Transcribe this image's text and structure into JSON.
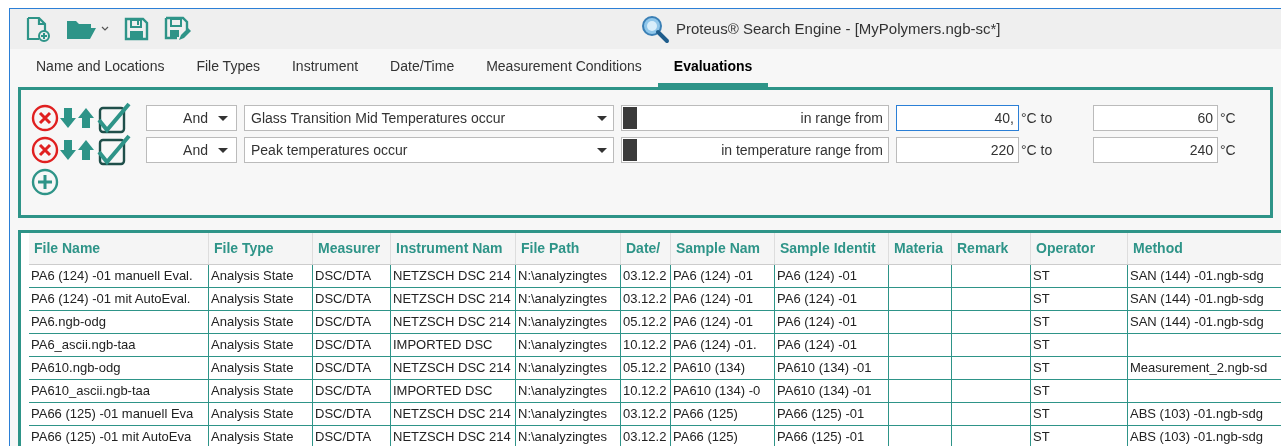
{
  "window": {
    "title": "Proteus® Search Engine - [MyPolymers.ngb-sc*]"
  },
  "tabs": [
    {
      "label": "Name and Locations",
      "selected": false
    },
    {
      "label": "File Types",
      "selected": false
    },
    {
      "label": "Instrument",
      "selected": false
    },
    {
      "label": "Date/Time",
      "selected": false
    },
    {
      "label": "Measurement Conditions",
      "selected": false
    },
    {
      "label": "Evaluations",
      "selected": true
    }
  ],
  "conditions": [
    {
      "enabled": true,
      "operator": "And",
      "criterion": "Glass Transition Mid Temperatures occur",
      "range_label": "in range from",
      "from": {
        "value": "40,",
        "focused": true
      },
      "from_unit": "°C to",
      "to": {
        "value": "60",
        "focused": false
      },
      "to_unit": "°C"
    },
    {
      "enabled": true,
      "operator": "And",
      "criterion": "Peak temperatures occur",
      "range_label": "in temperature range from",
      "from": {
        "value": "220",
        "focused": false
      },
      "from_unit": "°C to",
      "to": {
        "value": "240",
        "focused": false
      },
      "to_unit": "°C"
    }
  ],
  "table": {
    "columns": [
      "File Name",
      "File Type",
      "Measurer",
      "Instrument Nam",
      "File Path",
      "Date/",
      "Sample Nam",
      "Sample Identit",
      "Materia",
      "Remark",
      "Operator",
      "Method"
    ],
    "rows": [
      [
        "PA6 (124) -01 manuell Eval.",
        "Analysis State",
        "DSC/DTA",
        "NETZSCH DSC 214",
        "N:\\analyzingtes",
        "03.12.2",
        "PA6 (124) -01",
        "PA6 (124) -01",
        "",
        "",
        "ST",
        "SAN (144) -01.ngb-sdg"
      ],
      [
        "PA6 (124) -01 mit AutoEval.",
        "Analysis State",
        "DSC/DTA",
        "NETZSCH DSC 214",
        "N:\\analyzingtes",
        "03.12.2",
        "PA6 (124) -01",
        "PA6 (124) -01",
        "",
        "",
        "ST",
        "SAN (144) -01.ngb-sdg"
      ],
      [
        "PA6.ngb-odg",
        "Analysis State",
        "DSC/DTA",
        "NETZSCH DSC 214",
        "N:\\analyzingtes",
        "05.12.2",
        "PA6 (124) -01",
        "PA6 (124) -01",
        "",
        "",
        "ST",
        "SAN (144) -01.ngb-sdg"
      ],
      [
        "PA6_ascii.ngb-taa",
        "Analysis State",
        "DSC/DTA",
        "IMPORTED DSC",
        "N:\\analyzingtes",
        "10.12.2",
        "PA6 (124) -01.",
        "PA6 (124) -01",
        "",
        "",
        "ST",
        ""
      ],
      [
        "PA610.ngb-odg",
        "Analysis State",
        "DSC/DTA",
        "NETZSCH DSC 214",
        "N:\\analyzingtes",
        "05.12.2",
        "PA610 (134)",
        "PA610 (134) -01",
        "",
        "",
        "ST",
        "Measurement_2.ngb-sd"
      ],
      [
        "PA610_ascii.ngb-taa",
        "Analysis State",
        "DSC/DTA",
        "IMPORTED DSC",
        "N:\\analyzingtes",
        "10.12.2",
        "PA610 (134) -0",
        "PA610 (134) -01",
        "",
        "",
        "ST",
        ""
      ],
      [
        "PA66 (125) -01 manuell Eva",
        "Analysis State",
        "DSC/DTA",
        "NETZSCH DSC 214",
        "N:\\analyzingtes",
        "03.12.2",
        "PA66 (125)",
        "PA66 (125) -01",
        "",
        "",
        "ST",
        "ABS (103) -01.ngb-sdg"
      ],
      [
        "PA66 (125) -01 mit AutoEva",
        "Analysis State",
        "DSC/DTA",
        "NETZSCH DSC 214",
        "N:\\analyzingtes",
        "03.12.2",
        "PA66 (125)",
        "PA66 (125) -01",
        "",
        "",
        "ST",
        "ABS (103) -01.ngb-sdg"
      ]
    ]
  }
}
